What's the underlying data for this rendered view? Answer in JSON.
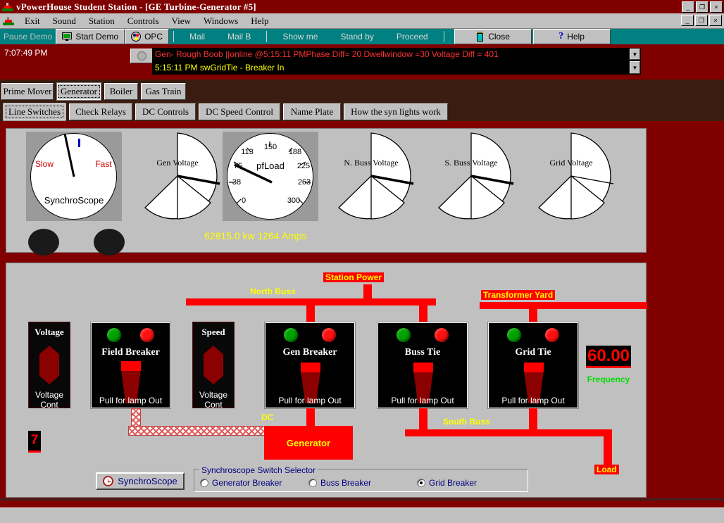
{
  "window": {
    "title": "vPowerHouse Student Station - [GE Turbine-Generator #5]",
    "app_icon": "powerplant-icon",
    "minimize": "_",
    "maximize": "❐",
    "close": "×"
  },
  "menu": {
    "items": [
      {
        "label": "Exit",
        "accel": "E"
      },
      {
        "label": "Sound",
        "accel": "o"
      },
      {
        "label": "Station",
        "accel": "S"
      },
      {
        "label": "Controls",
        "accel": "r"
      },
      {
        "label": "View",
        "accel": "V"
      },
      {
        "label": "Windows",
        "accel": "W"
      },
      {
        "label": "Help",
        "accel": "H"
      }
    ]
  },
  "toolbar": {
    "pause_demo": "Pause Demo",
    "start_demo": "Start Demo",
    "opc": "OPC",
    "mail": "Mail",
    "mail_b": "Mail B",
    "show_me": "Show me",
    "stand_by": "Stand by",
    "proceed": "Proceed",
    "close": "Close",
    "help": "Help"
  },
  "status": {
    "clock": "7:07:49 PM",
    "message_line1": "Gen- Rough   Boob ||online @5:15:11 PMPhase Diff= 20 Dwellwindow =30 Voltage Diff = 401",
    "message_line2": "5:15:11 PM swGridTie - Breaker In",
    "dropdown_arrow": "▼"
  },
  "tabs_primary": {
    "items": [
      "Prime Mover",
      "Generator",
      "Boiler",
      "Gas Train"
    ],
    "selected": "Generator"
  },
  "tabs_secondary": {
    "items": [
      "Line Switches",
      "Check Relays",
      "DC Controls",
      "DC Speed Control",
      "Name Plate",
      "How the syn lights work"
    ],
    "selected": "Line Switches"
  },
  "gauges": {
    "readout": "62815.0 kw 1264 Amps",
    "items": [
      {
        "name": "SynchroScope",
        "type": "synchroscope",
        "left_label": "Slow",
        "right_label": "Fast",
        "title": "SynchroScope",
        "needle_deg": -7
      },
      {
        "name": "Gen Voltage",
        "type": "wedge",
        "title": "Gen Voltage",
        "needle_deg": 80
      },
      {
        "name": "pfLoad",
        "type": "dial",
        "title": "pfLoad",
        "ticks": [
          "0",
          "38",
          "75",
          "113",
          "150",
          "188",
          "225",
          "263",
          "300"
        ],
        "needle_deg": -64
      },
      {
        "name": "N. Buss Voltage",
        "type": "wedge",
        "title": "N. Buss Voltage",
        "needle_deg": 80
      },
      {
        "name": "S. Buss Voltage",
        "type": "wedge",
        "title": "S. Buss Voltage",
        "needle_deg": 80
      },
      {
        "name": "Grid Voltage",
        "type": "wedge",
        "title": "Grid Voltage",
        "needle_deg": 80
      }
    ],
    "lamps": [
      "lamp-left",
      "lamp-right"
    ]
  },
  "diagram": {
    "station_power": "Station Power",
    "north_buss": "North Buss",
    "south_buss": "South Buss",
    "transformer_yard": "Transformer Yard",
    "dc": "DC",
    "generator": "Generator",
    "load": "Load",
    "counter_value": "7",
    "frequency_value": "60.00",
    "frequency_label": "Frequency",
    "pull_label": "Pull for lamp Out",
    "breakers": [
      {
        "name": "Field Breaker",
        "foot": "Pull for lamp Out"
      },
      {
        "name": "Gen Breaker",
        "foot": "Pull for lamp Out"
      },
      {
        "name": "Buss Tie",
        "foot": "Pull for lamp Out"
      },
      {
        "name": "Grid Tie",
        "foot": "Pull for lamp Out"
      }
    ],
    "controls": [
      {
        "name": "Voltage",
        "foot": "Voltage Cont"
      },
      {
        "name": "Speed",
        "foot": "Voltage Cont"
      }
    ]
  },
  "bottom": {
    "synchroscope_button": "SynchroScope",
    "selector_title": "Synchroscope Switch Selector",
    "options": [
      {
        "label": "Generator Breaker",
        "selected": false
      },
      {
        "label": "Buss Breaker",
        "selected": false
      },
      {
        "label": "Grid Breaker",
        "selected": true
      }
    ]
  },
  "colors": {
    "title_bar": "#800000",
    "toolbar": "#008080",
    "panel": "#c0c0c0",
    "bus_red": "#ff0000",
    "label_yellow": "#ffff00",
    "led_green": "#00a000",
    "led_red": "#ff1010"
  }
}
